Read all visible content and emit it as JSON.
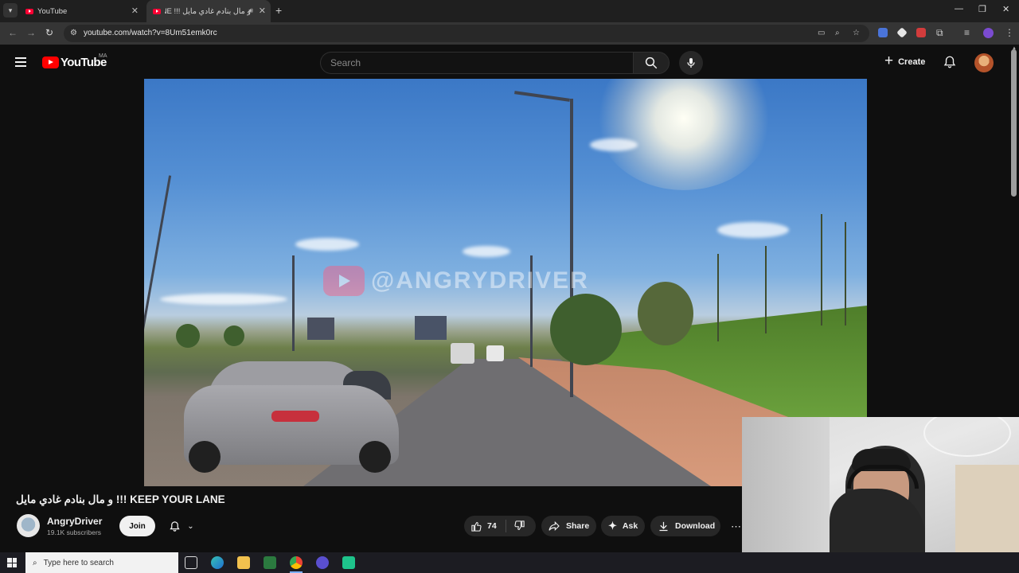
{
  "browser": {
    "tabs": [
      {
        "title": "YouTube",
        "active": false
      },
      {
        "title": "و مال بنادم غادي مايل !!! KEEP YOUR LANE",
        "active": true
      }
    ],
    "url": "youtube.com/watch?v=8Um51emk0rc"
  },
  "masthead": {
    "logo_text": "YouTube",
    "country_code": "MA",
    "search_placeholder": "Search",
    "create_label": "Create"
  },
  "player": {
    "watermark": "@ANGRYDRIVER"
  },
  "video": {
    "title": "و مال بنادم غادي مايل !!! KEEP YOUR LANE",
    "channel_name": "AngryDriver",
    "subscribers": "19.1K subscribers",
    "join_label": "Join",
    "like_count": "74",
    "share_label": "Share",
    "ask_label": "Ask",
    "download_label": "Download"
  },
  "taskbar": {
    "search_placeholder": "Type here to search"
  },
  "colors": {
    "yt_red": "#ff0000",
    "background": "#0f0f0f",
    "pill": "#272727"
  }
}
